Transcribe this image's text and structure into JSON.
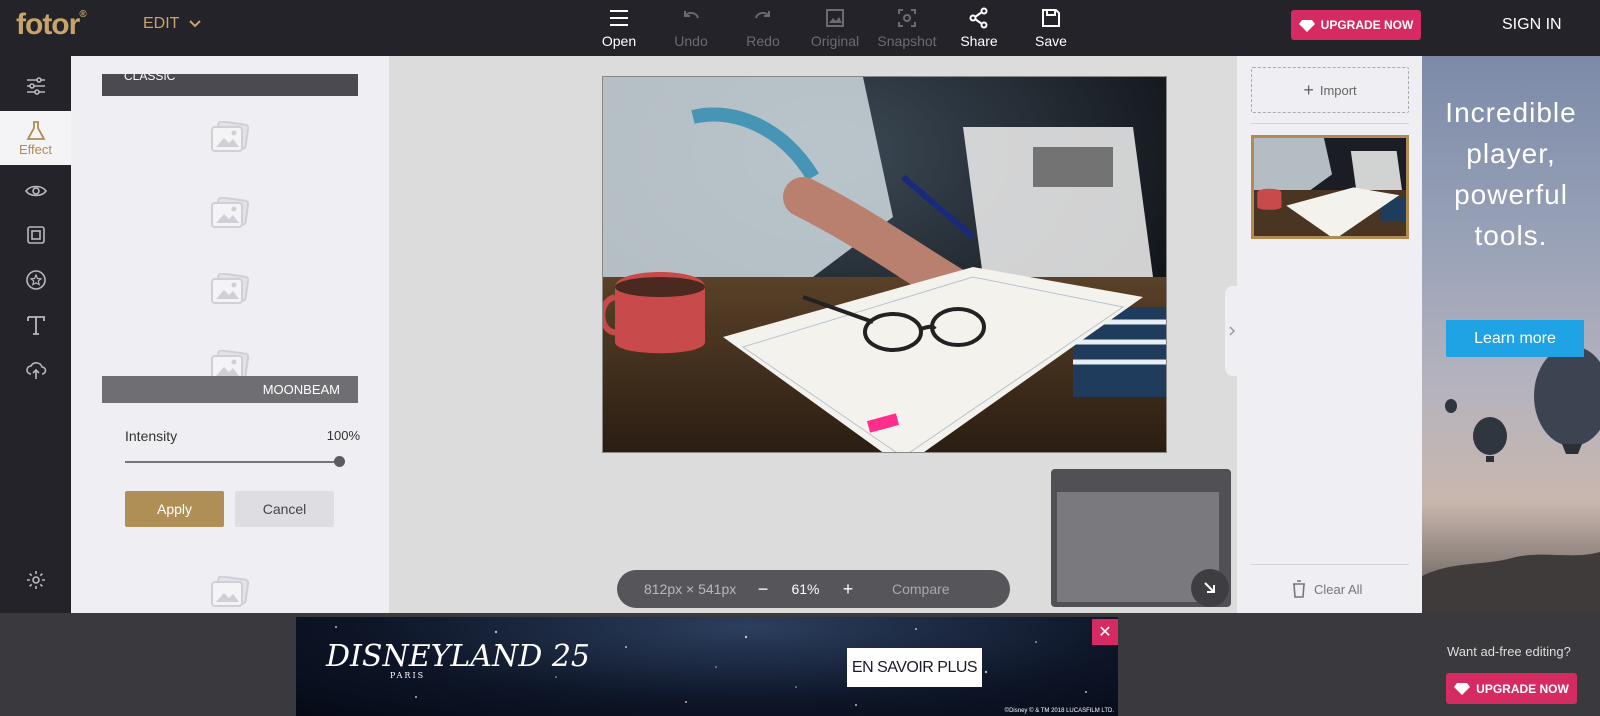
{
  "app": {
    "logo": "fotor",
    "logo_mark": "®",
    "mode_menu": "EDIT"
  },
  "toolbar": {
    "tools": [
      {
        "label": "Open",
        "icon": "menu-icon",
        "enabled": true
      },
      {
        "label": "Undo",
        "icon": "undo-icon",
        "enabled": false
      },
      {
        "label": "Redo",
        "icon": "redo-icon",
        "enabled": false
      },
      {
        "label": "Original",
        "icon": "image-icon",
        "enabled": false
      },
      {
        "label": "Snapshot",
        "icon": "snapshot-icon",
        "enabled": false
      },
      {
        "label": "Share",
        "icon": "share-icon",
        "enabled": true
      },
      {
        "label": "Save",
        "icon": "save-icon",
        "enabled": true
      }
    ],
    "upgrade": "UPGRADE NOW",
    "signin": "SIGN IN"
  },
  "leftnav": {
    "items": [
      {
        "name": "adjust",
        "icon": "sliders-icon"
      },
      {
        "name": "effect",
        "icon": "flask-icon",
        "label": "Effect",
        "active": true
      },
      {
        "name": "beauty",
        "icon": "eye-icon"
      },
      {
        "name": "frames",
        "icon": "frame-icon"
      },
      {
        "name": "stickers",
        "icon": "star-badge-icon"
      },
      {
        "name": "text",
        "icon": "text-icon"
      },
      {
        "name": "cloud",
        "icon": "cloud-upload-icon"
      },
      {
        "name": "settings",
        "icon": "gear-icon"
      }
    ]
  },
  "effect_panel": {
    "category_top": "CLASSIC",
    "selected_effect": "MOONBEAM",
    "intensity_label": "Intensity",
    "intensity_value": "100%",
    "intensity": 1.0,
    "apply": "Apply",
    "cancel": "Cancel"
  },
  "canvas": {
    "dimensions": "812px × 541px",
    "zoom": "61%",
    "zoom_minus": "−",
    "zoom_plus": "+",
    "compare": "Compare"
  },
  "right_panel": {
    "import": "Import",
    "clear_all": "Clear All"
  },
  "ad_right": {
    "headline_lines": [
      "Incredible",
      "player,",
      "powerful",
      "tools."
    ],
    "cta": "Learn more"
  },
  "ad_bottom": {
    "brand": "DISNEYLAND 25",
    "brand_sub": "PARIS",
    "cta": "EN SAVOIR PLUS",
    "legal": "©Disney © & TM 2018 LUCASFILM LTD.",
    "adfree_text": "Want ad-free editing?",
    "upgrade": "UPGRADE NOW",
    "close": "✕"
  },
  "colors": {
    "accent_gold": "#b08f57",
    "upgrade_pink": "#d62b62",
    "dark_bg": "#24232a",
    "learn_blue": "#1fa3e5"
  }
}
